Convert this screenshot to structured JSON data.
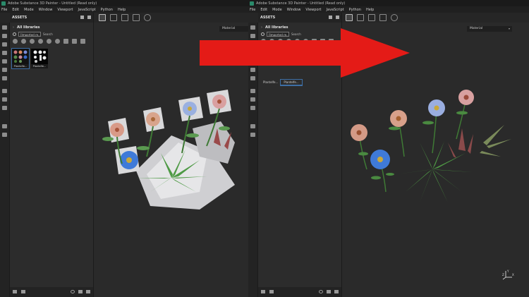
{
  "left_window": {
    "title": "Adobe Substance 3D Painter - Untitled (Read only)",
    "menu": [
      "File",
      "Edit",
      "Mode",
      "Window",
      "Viewport",
      "JavaScript",
      "Python",
      "Help"
    ],
    "assets_panel": {
      "title": "ASSETS",
      "library": "All libraries",
      "filter": "[Imported re...",
      "search_placeholder": "Search",
      "thumbnails": [
        {
          "label": "Plantelfe..."
        },
        {
          "label": "Plantelfe..."
        }
      ]
    },
    "viewport": {
      "material_dropdown": "Material"
    }
  },
  "right_window": {
    "title": "Adobe Substance 3D Painter - Untitled (Read only)",
    "menu": [
      "File",
      "Edit",
      "Mode",
      "Window",
      "Viewport",
      "JavaScript",
      "Python",
      "Help"
    ],
    "assets_panel": {
      "title": "ASSETS",
      "library": "All libraries",
      "filter": "[Imported re...",
      "search_placeholder": "Search",
      "tabs": [
        {
          "label": "Plantelfe...",
          "active": false
        },
        {
          "label": "Plantelfe...",
          "active": true
        }
      ]
    },
    "viewport": {
      "material_dropdown": "Material",
      "axis_labels": [
        "Y",
        "X",
        "Z"
      ]
    }
  },
  "icons": {
    "arrow": "right-arrow-overlay",
    "toolbar": [
      "grid-icon",
      "grid-alt-icon",
      "camera-icon",
      "frame-icon",
      "clock-icon"
    ]
  },
  "colors": {
    "arrow": "#e41b17",
    "selection": "#3e6fa6",
    "background": "#2b2b2b"
  }
}
